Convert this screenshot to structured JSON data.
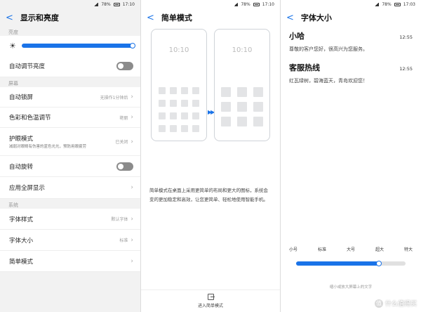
{
  "accent_color": "#1a73e8",
  "panel1": {
    "status": {
      "battery": "78%",
      "time": "17:10"
    },
    "title": "显示和亮度",
    "sections": {
      "brightness": "亮度",
      "screen": "屏幕",
      "system": "系统"
    },
    "brightness_level_percent": 100,
    "rows": {
      "auto_brightness": "自动调节亮度",
      "auto_lock": {
        "label": "自动锁屏",
        "value": "无操作1分钟后"
      },
      "color_temp": {
        "label": "色彩和色温调节",
        "value": "艳丽"
      },
      "eye_care": {
        "label": "护眼模式",
        "sub": "减弱对眼睛有伤害的蓝色光光，预防用眼疲劳",
        "value": "已关闭"
      },
      "auto_rotate": "自动旋转",
      "fullscreen": "应用全屏显示",
      "font_style": {
        "label": "字体样式",
        "value": "默认字体"
      },
      "font_size": {
        "label": "字体大小",
        "value": "标准"
      },
      "simple_mode": "简单模式"
    }
  },
  "panel2": {
    "status": {
      "battery": "78%",
      "time": "17:10"
    },
    "title": "简单模式",
    "phone_clock": "10:10",
    "description": "简单模式在桌面上采用更简单的布局和更大的图标，系统会变的更加稳定和高效，让您更简单、轻松地使用智能手机。",
    "enter_button": "进入简单模式"
  },
  "panel3": {
    "status": {
      "battery": "78%",
      "time": "17:03"
    },
    "title": "字体大小",
    "messages": [
      {
        "name": "小哈",
        "time": "12:55",
        "text": "尊敬的客户您好，很高兴为您服务。"
      },
      {
        "name": "客服热线",
        "time": "12:55",
        "text": "红瓦绿树，碧海蓝天，青岛欢迎您！"
      }
    ],
    "size_options": [
      "小号",
      "标准",
      "大号",
      "超大",
      "特大"
    ],
    "size_level_percent": 75,
    "hint": "缩小或放大屏幕上的文字",
    "watermark": "值 什么值得买"
  }
}
